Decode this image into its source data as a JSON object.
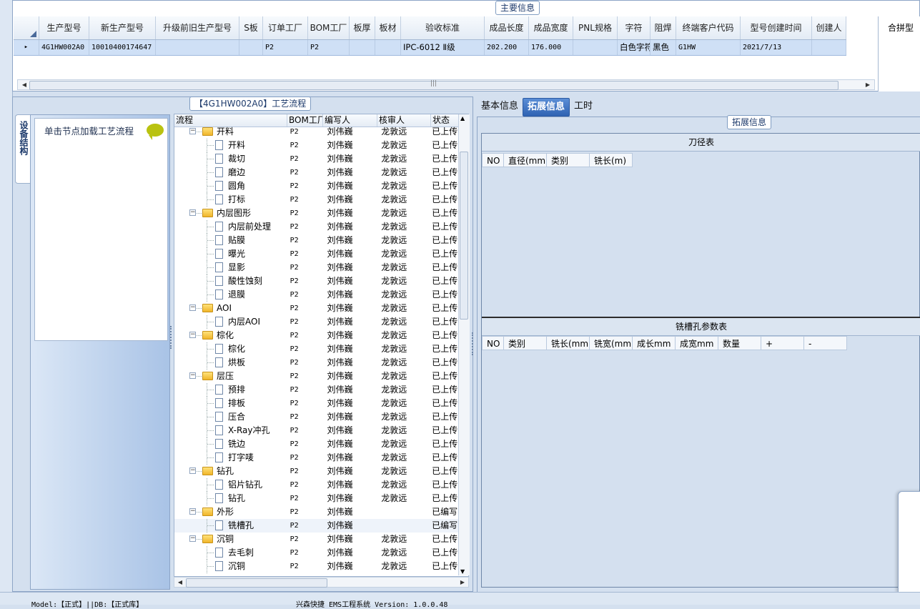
{
  "main_info": {
    "caption": "主要信息",
    "columns": [
      "生产型号",
      "新生产型号",
      "升级前旧生产型号",
      "S板",
      "订单工厂",
      "BOM工厂",
      "板厚",
      "板材",
      "验收标准",
      "成品长度",
      "成品宽度",
      "PNL规格",
      "字符",
      "阻焊",
      "终端客户代码",
      "型号创建时间",
      "创建人"
    ],
    "row": {
      "marker": "▸",
      "cells": [
        "4G1HW002A0",
        "10010400174647",
        "",
        "",
        "P2",
        "P2",
        "",
        "",
        "IPC-6012 Ⅱ级",
        "202.200",
        "176.000",
        "",
        "白色字符",
        "黑色",
        "G1HW",
        "2021/7/13",
        ""
      ]
    },
    "side_header": "合拼型"
  },
  "flow": {
    "caption": "【4G1HW002A0】工艺流程",
    "vertical_tab": "设备结构",
    "hint": "单击节点加载工艺流程",
    "columns": [
      "流程",
      "BOM工厂",
      "编写人",
      "核审人",
      "状态"
    ],
    "rows": [
      {
        "name": "开料",
        "type": "folder",
        "bom": "P2",
        "writer": "刘伟巍",
        "reviewer": "龙敦远",
        "status": "已上传"
      },
      {
        "name": "开料",
        "type": "doc",
        "bom": "P2",
        "writer": "刘伟巍",
        "reviewer": "龙敦远",
        "status": "已上传"
      },
      {
        "name": "裁切",
        "type": "doc",
        "bom": "P2",
        "writer": "刘伟巍",
        "reviewer": "龙敦远",
        "status": "已上传"
      },
      {
        "name": "磨边",
        "type": "doc",
        "bom": "P2",
        "writer": "刘伟巍",
        "reviewer": "龙敦远",
        "status": "已上传"
      },
      {
        "name": "圆角",
        "type": "doc",
        "bom": "P2",
        "writer": "刘伟巍",
        "reviewer": "龙敦远",
        "status": "已上传"
      },
      {
        "name": "打标",
        "type": "doc",
        "bom": "P2",
        "writer": "刘伟巍",
        "reviewer": "龙敦远",
        "status": "已上传"
      },
      {
        "name": "内层图形",
        "type": "folder",
        "bom": "P2",
        "writer": "刘伟巍",
        "reviewer": "龙敦远",
        "status": "已上传"
      },
      {
        "name": "内层前处理",
        "type": "doc",
        "bom": "P2",
        "writer": "刘伟巍",
        "reviewer": "龙敦远",
        "status": "已上传"
      },
      {
        "name": "贴膜",
        "type": "doc",
        "bom": "P2",
        "writer": "刘伟巍",
        "reviewer": "龙敦远",
        "status": "已上传"
      },
      {
        "name": "曝光",
        "type": "doc",
        "bom": "P2",
        "writer": "刘伟巍",
        "reviewer": "龙敦远",
        "status": "已上传"
      },
      {
        "name": "显影",
        "type": "doc",
        "bom": "P2",
        "writer": "刘伟巍",
        "reviewer": "龙敦远",
        "status": "已上传"
      },
      {
        "name": "酸性蚀刻",
        "type": "doc",
        "bom": "P2",
        "writer": "刘伟巍",
        "reviewer": "龙敦远",
        "status": "已上传"
      },
      {
        "name": "退膜",
        "type": "doc",
        "bom": "P2",
        "writer": "刘伟巍",
        "reviewer": "龙敦远",
        "status": "已上传"
      },
      {
        "name": "AOI",
        "type": "folder",
        "bom": "P2",
        "writer": "刘伟巍",
        "reviewer": "龙敦远",
        "status": "已上传"
      },
      {
        "name": "内层AOI",
        "type": "doc",
        "bom": "P2",
        "writer": "刘伟巍",
        "reviewer": "龙敦远",
        "status": "已上传"
      },
      {
        "name": "棕化",
        "type": "folder",
        "bom": "P2",
        "writer": "刘伟巍",
        "reviewer": "龙敦远",
        "status": "已上传"
      },
      {
        "name": "棕化",
        "type": "doc",
        "bom": "P2",
        "writer": "刘伟巍",
        "reviewer": "龙敦远",
        "status": "已上传"
      },
      {
        "name": "烘板",
        "type": "doc",
        "bom": "P2",
        "writer": "刘伟巍",
        "reviewer": "龙敦远",
        "status": "已上传"
      },
      {
        "name": "层压",
        "type": "folder",
        "bom": "P2",
        "writer": "刘伟巍",
        "reviewer": "龙敦远",
        "status": "已上传"
      },
      {
        "name": "预排",
        "type": "doc",
        "bom": "P2",
        "writer": "刘伟巍",
        "reviewer": "龙敦远",
        "status": "已上传"
      },
      {
        "name": "排板",
        "type": "doc",
        "bom": "P2",
        "writer": "刘伟巍",
        "reviewer": "龙敦远",
        "status": "已上传"
      },
      {
        "name": "压合",
        "type": "doc",
        "bom": "P2",
        "writer": "刘伟巍",
        "reviewer": "龙敦远",
        "status": "已上传"
      },
      {
        "name": "X-Ray冲孔",
        "type": "doc",
        "bom": "P2",
        "writer": "刘伟巍",
        "reviewer": "龙敦远",
        "status": "已上传"
      },
      {
        "name": "铣边",
        "type": "doc",
        "bom": "P2",
        "writer": "刘伟巍",
        "reviewer": "龙敦远",
        "status": "已上传"
      },
      {
        "name": "打字唛",
        "type": "doc",
        "bom": "P2",
        "writer": "刘伟巍",
        "reviewer": "龙敦远",
        "status": "已上传"
      },
      {
        "name": "钻孔",
        "type": "folder",
        "bom": "P2",
        "writer": "刘伟巍",
        "reviewer": "龙敦远",
        "status": "已上传"
      },
      {
        "name": "铝片钻孔",
        "type": "doc",
        "bom": "P2",
        "writer": "刘伟巍",
        "reviewer": "龙敦远",
        "status": "已上传"
      },
      {
        "name": "钻孔",
        "type": "doc",
        "bom": "P2",
        "writer": "刘伟巍",
        "reviewer": "龙敦远",
        "status": "已上传"
      },
      {
        "name": "外形",
        "type": "folder",
        "bom": "P2",
        "writer": "刘伟巍",
        "reviewer": "",
        "status": "已编写"
      },
      {
        "name": "铣槽孔",
        "type": "doc",
        "bom": "P2",
        "writer": "刘伟巍",
        "reviewer": "",
        "status": "已编写",
        "selected": true
      },
      {
        "name": "沉铜",
        "type": "folder",
        "bom": "P2",
        "writer": "刘伟巍",
        "reviewer": "龙敦远",
        "status": "已上传"
      },
      {
        "name": "去毛刺",
        "type": "doc",
        "bom": "P2",
        "writer": "刘伟巍",
        "reviewer": "龙敦远",
        "status": "已上传"
      },
      {
        "name": "沉铜",
        "type": "doc",
        "bom": "P2",
        "writer": "刘伟巍",
        "reviewer": "龙敦远",
        "status": "已上传"
      }
    ]
  },
  "right": {
    "tabs": [
      "基本信息",
      "拓展信息",
      "工时"
    ],
    "active_tab": 1,
    "ext_caption": "拓展信息",
    "tool_table": {
      "title": "刀径表",
      "columns": [
        "NO",
        "直径(mm)",
        "类别",
        "铣长(m)"
      ]
    },
    "slot_table": {
      "title": "铣槽孔参数表",
      "columns": [
        "NO",
        "类别",
        "铣长(mm)",
        "铣宽(mm)",
        "成长mm",
        "成宽mm",
        "数量",
        "+",
        "-"
      ]
    }
  },
  "status": {
    "model": "Model:【正式】||DB:【正式库】",
    "system": "兴森快捷 EMS工程系统 Version: 1.0.0.48"
  },
  "colors": {
    "accent": "#2f63b3",
    "selected_row": "#cfe0f6",
    "folder": "#f0b52a"
  }
}
